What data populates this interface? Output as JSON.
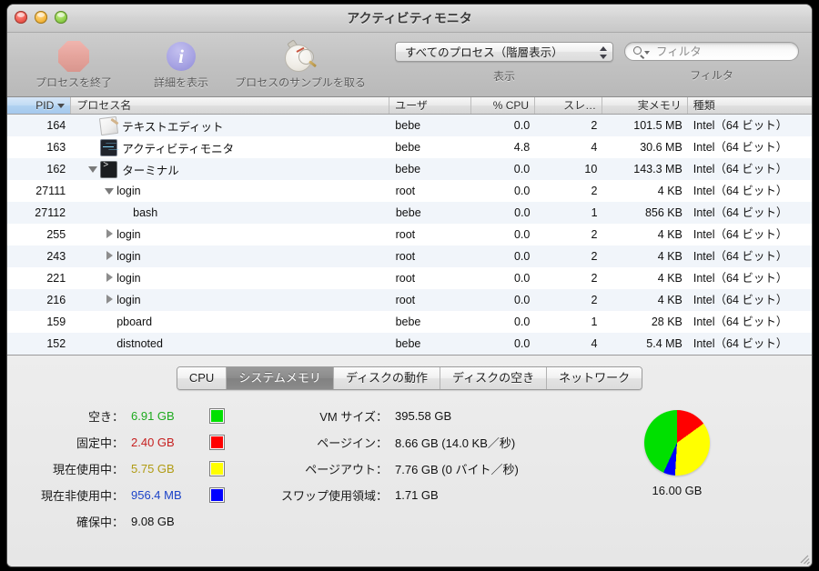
{
  "window": {
    "title": "アクティビティモニタ",
    "controls": {
      "close": "close",
      "minimize": "minimize",
      "zoom": "zoom"
    }
  },
  "toolbar": {
    "buttons": [
      {
        "label": "プロセスを終了",
        "icon": "stop-octagon-icon"
      },
      {
        "label": "詳細を表示",
        "icon": "info-circle-icon"
      },
      {
        "label": "プロセスのサンプルを取る",
        "icon": "stopwatch-magnifier-icon"
      }
    ],
    "view_popup": {
      "value": "すべてのプロセス（階層表示）",
      "caption": "表示"
    },
    "filter": {
      "placeholder": "フィルタ",
      "value": "",
      "caption": "フィルタ"
    }
  },
  "table": {
    "columns": [
      {
        "key": "pid",
        "label": "PID",
        "sorted": true,
        "sort_dir": "desc"
      },
      {
        "key": "name",
        "label": "プロセス名"
      },
      {
        "key": "user",
        "label": "ユーザ"
      },
      {
        "key": "cpu",
        "label": "% CPU"
      },
      {
        "key": "threads",
        "label": "スレ…"
      },
      {
        "key": "memory",
        "label": "実メモリ"
      },
      {
        "key": "kind",
        "label": "種類"
      }
    ],
    "rows": [
      {
        "pid": "164",
        "name": "テキストエディット",
        "user": "bebe",
        "cpu": "0.0",
        "threads": "2",
        "memory": "101.5 MB",
        "kind": "Intel（64 ビット）",
        "indent": 1,
        "twisty": "none",
        "icon": "textedit-icon"
      },
      {
        "pid": "163",
        "name": "アクティビティモニタ",
        "user": "bebe",
        "cpu": "4.8",
        "threads": "4",
        "memory": "30.6 MB",
        "kind": "Intel（64 ビット）",
        "indent": 1,
        "twisty": "none",
        "icon": "activity-monitor-icon"
      },
      {
        "pid": "162",
        "name": "ターミナル",
        "user": "bebe",
        "cpu": "0.0",
        "threads": "10",
        "memory": "143.3 MB",
        "kind": "Intel（64 ビット）",
        "indent": 1,
        "twisty": "down",
        "icon": "terminal-icon"
      },
      {
        "pid": "27111",
        "name": "login",
        "user": "root",
        "cpu": "0.0",
        "threads": "2",
        "memory": "4 KB",
        "kind": "Intel（64 ビット）",
        "indent": 2,
        "twisty": "down",
        "icon": "none"
      },
      {
        "pid": "27112",
        "name": "bash",
        "user": "bebe",
        "cpu": "0.0",
        "threads": "1",
        "memory": "856 KB",
        "kind": "Intel（64 ビット）",
        "indent": 3,
        "twisty": "none",
        "icon": "none"
      },
      {
        "pid": "255",
        "name": "login",
        "user": "root",
        "cpu": "0.0",
        "threads": "2",
        "memory": "4 KB",
        "kind": "Intel（64 ビット）",
        "indent": 2,
        "twisty": "right",
        "icon": "none"
      },
      {
        "pid": "243",
        "name": "login",
        "user": "root",
        "cpu": "0.0",
        "threads": "2",
        "memory": "4 KB",
        "kind": "Intel（64 ビット）",
        "indent": 2,
        "twisty": "right",
        "icon": "none"
      },
      {
        "pid": "221",
        "name": "login",
        "user": "root",
        "cpu": "0.0",
        "threads": "2",
        "memory": "4 KB",
        "kind": "Intel（64 ビット）",
        "indent": 2,
        "twisty": "right",
        "icon": "none"
      },
      {
        "pid": "216",
        "name": "login",
        "user": "root",
        "cpu": "0.0",
        "threads": "2",
        "memory": "4 KB",
        "kind": "Intel（64 ビット）",
        "indent": 2,
        "twisty": "right",
        "icon": "none"
      },
      {
        "pid": "159",
        "name": "pboard",
        "user": "bebe",
        "cpu": "0.0",
        "threads": "1",
        "memory": "28 KB",
        "kind": "Intel（64 ビット）",
        "indent": 2,
        "twisty": "none",
        "icon": "none"
      },
      {
        "pid": "152",
        "name": "distnoted",
        "user": "bebe",
        "cpu": "0.0",
        "threads": "4",
        "memory": "5.4 MB",
        "kind": "Intel（64 ビット）",
        "indent": 2,
        "twisty": "none",
        "icon": "none"
      }
    ]
  },
  "bottom": {
    "tabs": [
      {
        "label": "CPU",
        "active": false
      },
      {
        "label": "システムメモリ",
        "active": true
      },
      {
        "label": "ディスクの動作",
        "active": false
      },
      {
        "label": "ディスクの空き",
        "active": false
      },
      {
        "label": "ネットワーク",
        "active": false
      }
    ],
    "memory_stats": [
      {
        "label": "空き：",
        "value": "6.91 GB",
        "color": "#1eaa1e",
        "swatch": "#00e000"
      },
      {
        "label": "固定中：",
        "value": "2.40 GB",
        "color": "#c62020",
        "swatch": "#ff0000"
      },
      {
        "label": "現在使用中：",
        "value": "5.75 GB",
        "color": "#b09b12",
        "swatch": "#ffff00"
      },
      {
        "label": "現在非使用中：",
        "value": "956.4 MB",
        "color": "#1c43c8",
        "swatch": "#0000ff"
      },
      {
        "label": "確保中：",
        "value": "9.08 GB",
        "color": "#111111",
        "swatch": "none"
      }
    ],
    "vm_stats": [
      {
        "label": "VM サイズ：",
        "value": "395.58 GB"
      },
      {
        "label": "ページイン：",
        "value": "8.66 GB (14.0 KB／秒)"
      },
      {
        "label": "ページアウト：",
        "value": "7.76 GB (0 バイト／秒)"
      },
      {
        "label": "スワップ使用領域：",
        "value": "1.71 GB"
      }
    ],
    "pie_total": "16.00 GB"
  },
  "chart_data": {
    "type": "pie",
    "title": "システムメモリ",
    "total_label": "16.00 GB",
    "total_gb": 16.0,
    "labels": [
      "空き",
      "固定中",
      "現在使用中",
      "現在非使用中"
    ],
    "values_gb": [
      6.91,
      2.4,
      5.75,
      0.9336
    ],
    "value_labels": [
      "6.91 GB",
      "2.40 GB",
      "5.75 GB",
      "956.4 MB"
    ],
    "colors": [
      "#00e000",
      "#ff0000",
      "#ffff00",
      "#0000ff"
    ],
    "legend_position": "left"
  }
}
